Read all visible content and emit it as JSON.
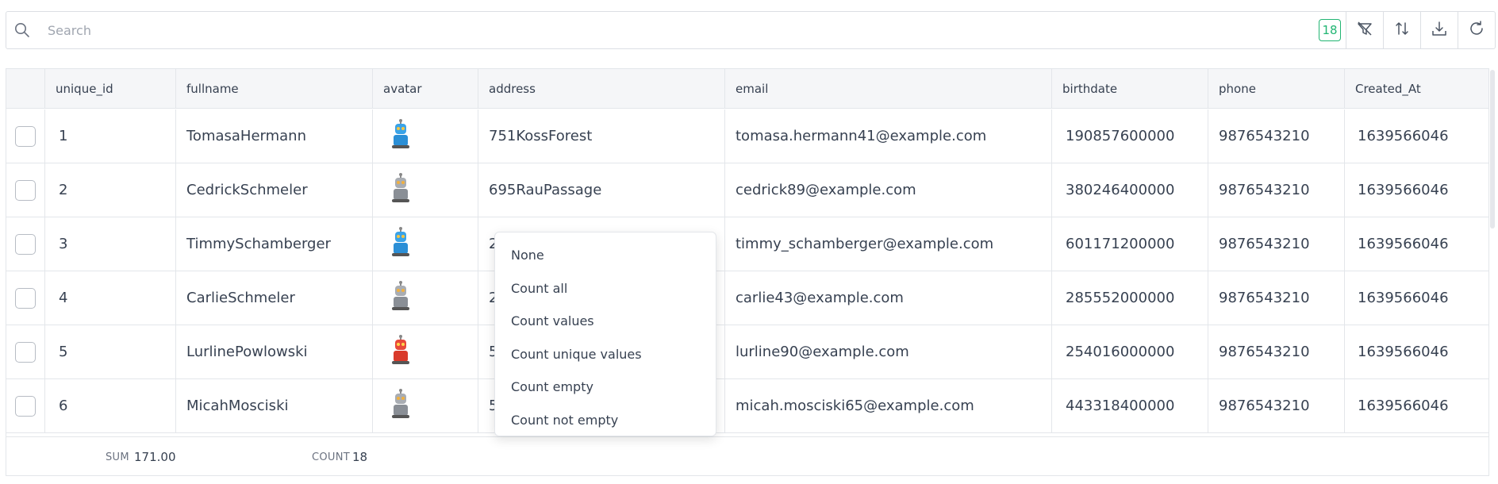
{
  "search": {
    "placeholder": "Search",
    "value": ""
  },
  "toolbar": {
    "record_count": "18",
    "buttons": [
      "filter-icon",
      "sort-icon",
      "download-icon",
      "refresh-icon"
    ]
  },
  "columns": [
    "unique_id",
    "fullname",
    "avatar",
    "address",
    "email",
    "birthdate",
    "phone",
    "Created_At"
  ],
  "rows": [
    {
      "unique_id": "1",
      "fullname": "TomasaHermann",
      "avatar": "blue-robot",
      "address": "751KossForest",
      "email": "tomasa.hermann41@example.com",
      "birthdate": "190857600000",
      "phone": "9876543210",
      "created_at": "1639566046"
    },
    {
      "unique_id": "2",
      "fullname": "CedrickSchmeler",
      "avatar": "grey-robot",
      "address": "695RauPassage",
      "email": "cedrick89@example.com",
      "birthdate": "380246400000",
      "phone": "9876543210",
      "created_at": "1639566046"
    },
    {
      "unique_id": "3",
      "fullname": "TimmySchamberger",
      "avatar": "blue-robot",
      "address": "2",
      "email": "timmy_schamberger@example.com",
      "birthdate": "601171200000",
      "phone": "9876543210",
      "created_at": "1639566046"
    },
    {
      "unique_id": "4",
      "fullname": "CarlieSchmeler",
      "avatar": "grey-robot",
      "address": "2",
      "email": "carlie43@example.com",
      "birthdate": "285552000000",
      "phone": "9876543210",
      "created_at": "1639566046"
    },
    {
      "unique_id": "5",
      "fullname": "LurlinePowlowski",
      "avatar": "red-robot",
      "address": "5",
      "email": "lurline90@example.com",
      "birthdate": "254016000000",
      "phone": "9876543210",
      "created_at": "1639566046"
    },
    {
      "unique_id": "6",
      "fullname": "MicahMosciski",
      "avatar": "grey-robot",
      "address": "5",
      "email": "micah.mosciski65@example.com",
      "birthdate": "443318400000",
      "phone": "9876543210",
      "created_at": "1639566046"
    }
  ],
  "footer": {
    "sum_label": "SUM",
    "sum_value": "171.00",
    "count_label": "COUNT",
    "count_value": "18"
  },
  "aggregate_menu": [
    "None",
    "Count all",
    "Count values",
    "Count unique values",
    "Count empty",
    "Count not empty"
  ],
  "colors": {
    "accent": "#22b573",
    "border": "#e3e6ea",
    "header_bg": "#f5f6f8"
  }
}
